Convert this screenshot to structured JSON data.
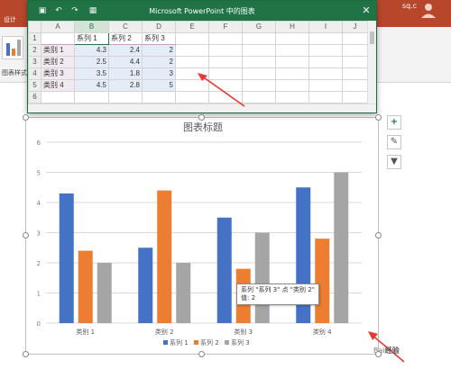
{
  "ppt": {
    "tab_label": "设计",
    "user_label": "sq.c",
    "chart_style_label": "图表样式",
    "accent_color": "#b7472a"
  },
  "excel": {
    "title": "Microsoft PowerPoint 中的图表",
    "title_bar_color": "#217346",
    "columns": [
      "A",
      "B",
      "C",
      "D",
      "E",
      "F",
      "G",
      "H",
      "I",
      "J"
    ],
    "header_row": [
      "",
      "系列 1",
      "系列 2",
      "系列 3"
    ],
    "rows": [
      {
        "num": "2",
        "cells": [
          "类别 1",
          "4.3",
          "2.4",
          "2"
        ]
      },
      {
        "num": "3",
        "cells": [
          "类别 2",
          "2.5",
          "4.4",
          "2"
        ]
      },
      {
        "num": "4",
        "cells": [
          "类别 3",
          "3.5",
          "1.8",
          "3"
        ]
      },
      {
        "num": "5",
        "cells": [
          "类别 4",
          "4.5",
          "2.8",
          "5"
        ]
      }
    ]
  },
  "chart_data": {
    "type": "bar",
    "title": "图表标题",
    "categories": [
      "类别 1",
      "类别 2",
      "类别 3",
      "类别 4"
    ],
    "series": [
      {
        "name": "系列 1",
        "values": [
          4.3,
          2.5,
          3.5,
          4.5
        ],
        "color": "#4472c4"
      },
      {
        "name": "系列 2",
        "values": [
          2.4,
          4.4,
          1.8,
          2.8
        ],
        "color": "#ed7d31"
      },
      {
        "name": "系列 3",
        "values": [
          2,
          2,
          3,
          5
        ],
        "color": "#a5a5a5"
      }
    ],
    "ylim": [
      0,
      6
    ],
    "yticks": [
      0,
      1,
      2,
      3,
      4,
      5,
      6
    ],
    "grid": true,
    "legend_position": "bottom"
  },
  "tooltip": {
    "line1": "系列 \"系列 3\" 点 \"类别 2\"",
    "line2": "值: 2"
  },
  "side_buttons": {
    "add": "+",
    "style": "✎",
    "filter": "▼"
  },
  "watermark": {
    "prefix": "Bai",
    "brand": "经验"
  }
}
